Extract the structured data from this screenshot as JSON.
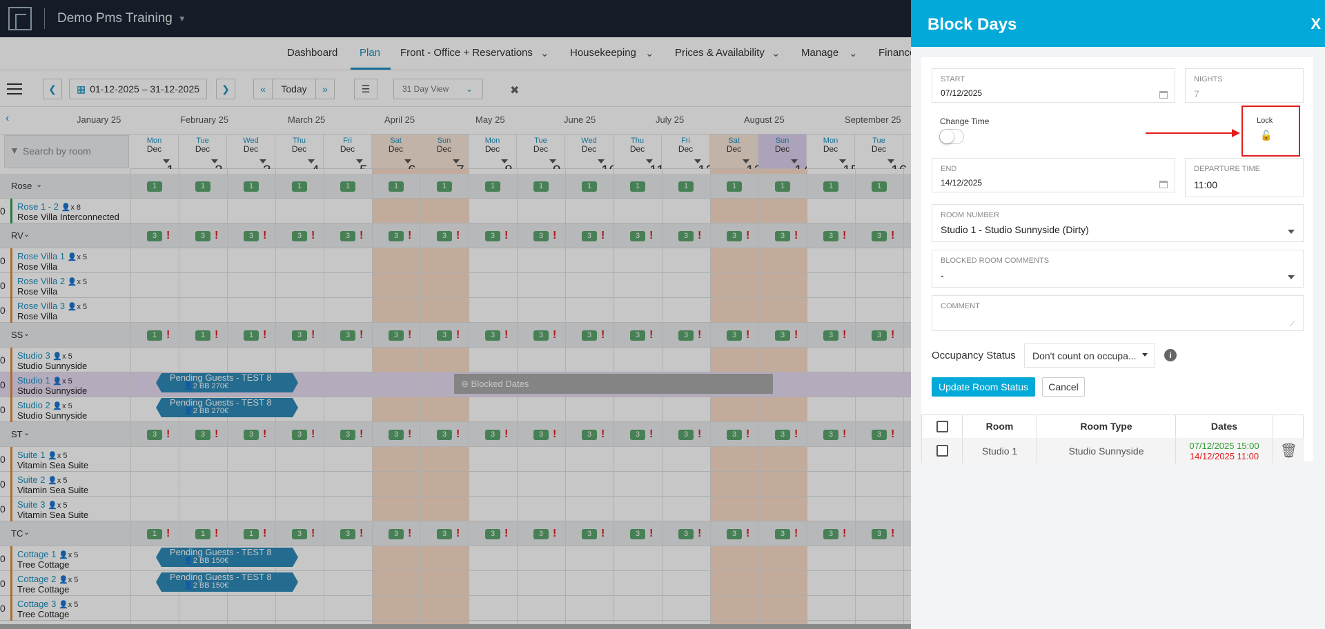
{
  "app": {
    "title": "Demo Pms Training"
  },
  "nav": {
    "items": [
      "Dashboard",
      "Plan",
      "Front - Office + Reservations",
      "Housekeeping",
      "Prices & Availability",
      "Manage",
      "Finance"
    ]
  },
  "toolbar": {
    "date_range": "01-12-2025 – 31-12-2025",
    "today": "Today",
    "view": "31 Day View"
  },
  "months": [
    "January 25",
    "February 25",
    "March 25",
    "April 25",
    "May 25",
    "June 25",
    "July 25",
    "August 25",
    "September 25"
  ],
  "search": {
    "placeholder": "Search by room"
  },
  "days": [
    {
      "dow": "Mon",
      "day": "1",
      "mon": "Dec"
    },
    {
      "dow": "Tue",
      "day": "2",
      "mon": "Dec"
    },
    {
      "dow": "Wed",
      "day": "3",
      "mon": "Dec"
    },
    {
      "dow": "Thu",
      "day": "4",
      "mon": "Dec"
    },
    {
      "dow": "Fri",
      "day": "5",
      "mon": "Dec"
    },
    {
      "dow": "Sat",
      "day": "6",
      "mon": "Dec"
    },
    {
      "dow": "Sun",
      "day": "7",
      "mon": "Dec"
    },
    {
      "dow": "Mon",
      "day": "8",
      "mon": "Dec"
    },
    {
      "dow": "Tue",
      "day": "9",
      "mon": "Dec"
    },
    {
      "dow": "Wed",
      "day": "10",
      "mon": "Dec"
    },
    {
      "dow": "Thu",
      "day": "11",
      "mon": "Dec"
    },
    {
      "dow": "Fri",
      "day": "12",
      "mon": "Dec"
    },
    {
      "dow": "Sat",
      "day": "13",
      "mon": "Dec"
    },
    {
      "dow": "Sun",
      "day": "14",
      "mon": "Dec"
    },
    {
      "dow": "Mon",
      "day": "15",
      "mon": "Dec"
    },
    {
      "dow": "Tue",
      "day": "16",
      "mon": "Dec"
    }
  ],
  "groups": [
    {
      "name": "Rose",
      "availability": [
        "1",
        "1",
        "1",
        "1",
        "1",
        "1",
        "1",
        "1",
        "1",
        "1",
        "1",
        "1",
        "1",
        "1",
        "1",
        "1"
      ],
      "alert": [
        false,
        false,
        false,
        false,
        false,
        false,
        false,
        false,
        false,
        false,
        false,
        false,
        false,
        false,
        false,
        false
      ],
      "rooms": [
        {
          "num": "0",
          "name": "Rose 1 - 2",
          "cap": "x 8",
          "type": "Rose Villa Interconnected"
        }
      ]
    },
    {
      "name": "RV",
      "availability": [
        "3",
        "3",
        "3",
        "3",
        "3",
        "3",
        "3",
        "3",
        "3",
        "3",
        "3",
        "3",
        "3",
        "3",
        "3",
        "3"
      ],
      "alert": [
        true,
        true,
        true,
        true,
        true,
        true,
        true,
        true,
        true,
        true,
        true,
        true,
        true,
        true,
        true,
        true
      ],
      "rooms": [
        {
          "num": "0",
          "name": "Rose Villa 1",
          "cap": "x 5",
          "type": "Rose Villa"
        },
        {
          "num": "0",
          "name": "Rose Villa 2",
          "cap": "x 5",
          "type": "Rose Villa"
        },
        {
          "num": "0",
          "name": "Rose Villa 3",
          "cap": "x 5",
          "type": "Rose Villa"
        }
      ]
    },
    {
      "name": "SS",
      "availability": [
        "1",
        "1",
        "1",
        "3",
        "3",
        "3",
        "3",
        "3",
        "3",
        "3",
        "3",
        "3",
        "3",
        "3",
        "3",
        "3"
      ],
      "alert": [
        true,
        true,
        true,
        true,
        true,
        true,
        true,
        true,
        true,
        true,
        true,
        true,
        true,
        true,
        true,
        true
      ],
      "rooms": [
        {
          "num": "0",
          "name": "Studio 3",
          "cap": "x 5",
          "type": "Studio Sunnyside"
        },
        {
          "num": "0",
          "name": "Studio 1",
          "cap": "x 5",
          "type": "Studio Sunnyside"
        },
        {
          "num": "0",
          "name": "Studio 2",
          "cap": "x 5",
          "type": "Studio Sunnyside"
        }
      ]
    },
    {
      "name": "ST",
      "availability": [
        "3",
        "3",
        "3",
        "3",
        "3",
        "3",
        "3",
        "3",
        "3",
        "3",
        "3",
        "3",
        "3",
        "3",
        "3",
        "3"
      ],
      "alert": [
        true,
        true,
        true,
        true,
        true,
        true,
        true,
        true,
        true,
        true,
        true,
        true,
        true,
        true,
        true,
        true
      ],
      "rooms": [
        {
          "num": "0",
          "name": "Suite 1",
          "cap": "x 5",
          "type": "Vitamin Sea Suite"
        },
        {
          "num": "0",
          "name": "Suite 2",
          "cap": "x 5",
          "type": "Vitamin Sea Suite"
        },
        {
          "num": "0",
          "name": "Suite 3",
          "cap": "x 5",
          "type": "Vitamin Sea Suite"
        }
      ]
    },
    {
      "name": "TC",
      "availability": [
        "1",
        "1",
        "1",
        "3",
        "3",
        "3",
        "3",
        "3",
        "3",
        "3",
        "3",
        "3",
        "3",
        "3",
        "3",
        "3"
      ],
      "alert": [
        true,
        true,
        true,
        true,
        true,
        true,
        true,
        true,
        true,
        true,
        true,
        true,
        true,
        true,
        true,
        true
      ],
      "rooms": [
        {
          "num": "0",
          "name": "Cottage 1",
          "cap": "x 5",
          "type": "Tree Cottage"
        },
        {
          "num": "0",
          "name": "Cottage 2",
          "cap": "x 5",
          "type": "Tree Cottage"
        },
        {
          "num": "0",
          "name": "Cottage 3",
          "cap": "x 5",
          "type": "Tree Cottage"
        }
      ]
    }
  ],
  "bookings": [
    {
      "title": "Pending Guests - TEST 8",
      "guests": "2",
      "board": "BB",
      "price": "270€"
    },
    {
      "title": "Pending Guests - TEST 8",
      "guests": "2",
      "board": "BB",
      "price": "270€"
    },
    {
      "title": "Pending Guests - TEST 8",
      "guests": "2",
      "board": "BB",
      "price": "150€"
    },
    {
      "title": "Pending Guests - TEST 8",
      "guests": "2",
      "board": "BB",
      "price": "150€"
    }
  ],
  "blocked": {
    "label": "Blocked Dates"
  },
  "panel": {
    "title": "Block Days",
    "close": "X",
    "start_label": "START",
    "start_value": "07/12/2025",
    "nights_label": "NIGHTS",
    "nights_value": "7",
    "change_time_label": "Change Time",
    "lock_label": "Lock",
    "end_label": "END",
    "end_value": "14/12/2025",
    "departure_label": "DEPARTURE TIME",
    "departure_value": "11:00",
    "room_number_label": "ROOM NUMBER",
    "room_number_value": "Studio 1 - Studio Sunnyside (Dirty)",
    "blocked_comments_label": "BLOCKED ROOM COMMENTS",
    "blocked_comments_value": "-",
    "comment_label": "COMMENT",
    "occupancy_label": "Occupancy Status",
    "occupancy_value": "Don't count on occupa...",
    "update_button": "Update Room Status",
    "cancel_button": "Cancel",
    "table": {
      "headers": [
        "Room",
        "Room Type",
        "Dates"
      ],
      "rows": [
        {
          "room": "Studio 1",
          "type": "Studio Sunnyside",
          "start": "07/12/2025 15:00",
          "end": "14/12/2025 11:00"
        }
      ]
    }
  },
  "colors": {
    "accent": "#03a9d8",
    "header_dark": "#1b2534",
    "available": "#5ba56e",
    "alert": "#e31b1b",
    "weekend": "#f9dcc7",
    "booking": "#2e8ab8"
  }
}
